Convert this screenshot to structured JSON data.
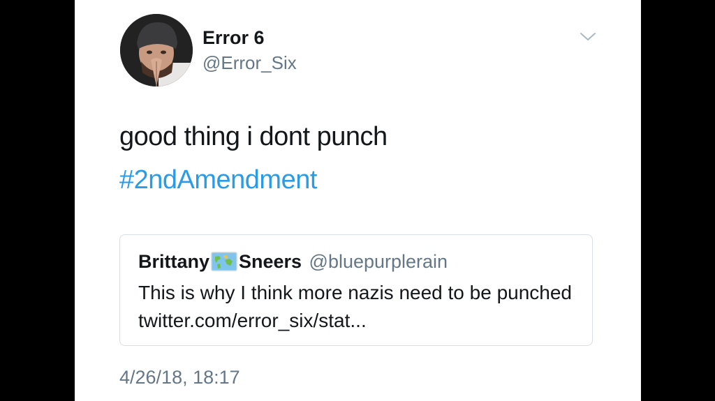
{
  "author": {
    "display_name": "Error 6",
    "handle": "@Error_Six",
    "avatar_icon": "profile-photo"
  },
  "tweet": {
    "text": "good thing i dont punch",
    "hashtag": "#2ndAmendment",
    "timestamp": "4/26/18, 18:17",
    "menu_icon": "chevron-down-icon"
  },
  "quoted_tweet": {
    "name_first": "Brittany",
    "name_emoji": "world-map-emoji",
    "name_last": "Sneers",
    "handle": "@bluepurplerain",
    "text": "This is why I think more nazis need to be punched twitter.com/error_six/stat..."
  },
  "colors": {
    "link": "#2a9be6",
    "secondary_text": "#657786",
    "primary_text": "#14171a",
    "background": "#000000",
    "card": "#ffffff"
  }
}
